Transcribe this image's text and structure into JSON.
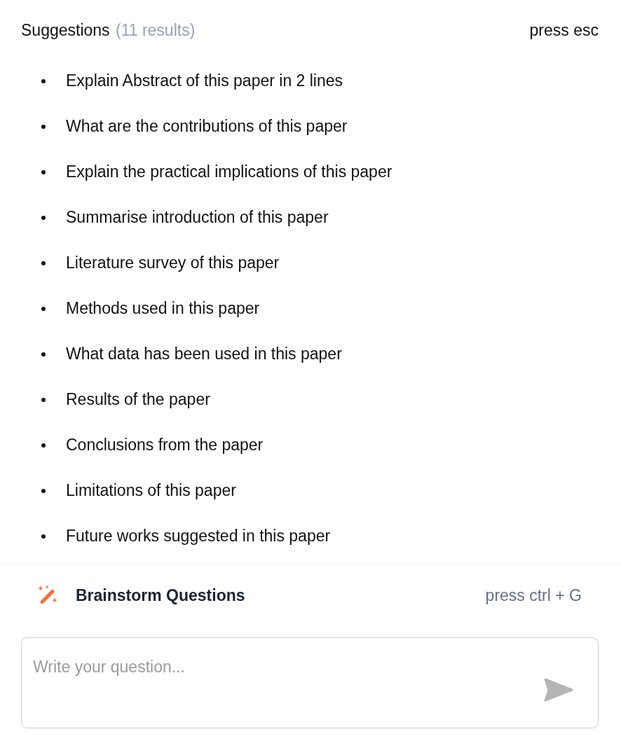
{
  "header": {
    "title": "Suggestions",
    "count": "(11 results)",
    "hint": "press esc"
  },
  "suggestions": [
    {
      "text": "Explain Abstract of this paper in 2 lines"
    },
    {
      "text": "What are the contributions of this paper"
    },
    {
      "text": "Explain the practical implications of this paper"
    },
    {
      "text": "Summarise introduction of this paper"
    },
    {
      "text": "Literature survey of this paper"
    },
    {
      "text": "Methods used in this paper"
    },
    {
      "text": "What data has been used in this paper"
    },
    {
      "text": "Results of the paper"
    },
    {
      "text": "Conclusions from the paper"
    },
    {
      "text": "Limitations of this paper"
    },
    {
      "text": "Future works suggested in this paper"
    }
  ],
  "brainstorm": {
    "label": "Brainstorm Questions",
    "shortcut": "press ctrl + G"
  },
  "question_field": {
    "placeholder": "Write your question..."
  }
}
